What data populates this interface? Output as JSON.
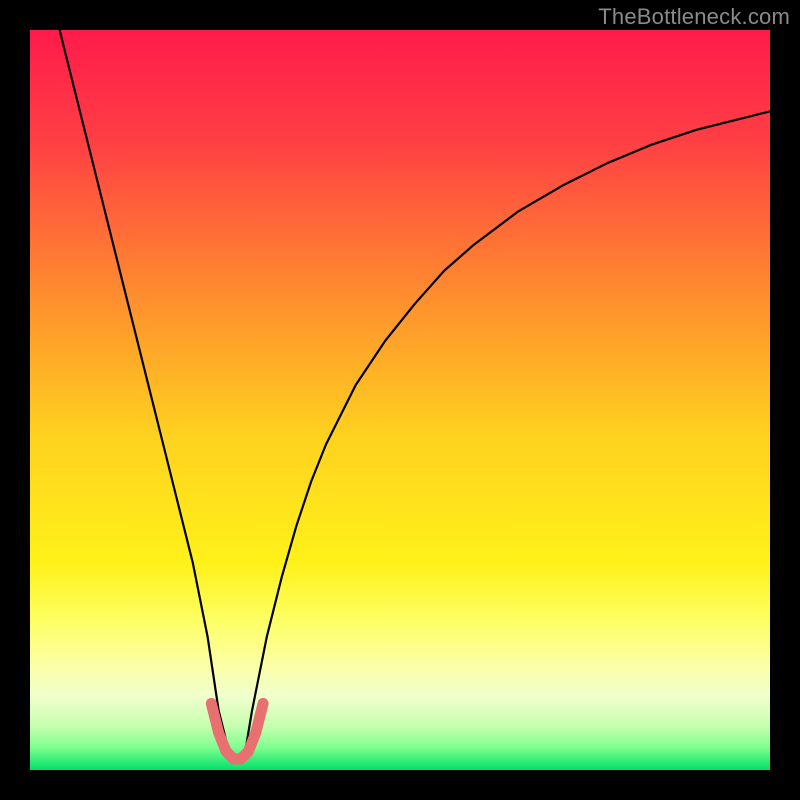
{
  "watermark": "TheBottleneck.com",
  "chart_data": {
    "type": "line",
    "title": "",
    "xlabel": "",
    "ylabel": "",
    "xlim": [
      0,
      100
    ],
    "ylim": [
      0,
      100
    ],
    "legend": false,
    "grid": false,
    "background_gradient": {
      "stops": [
        {
          "offset": 0.0,
          "color": "#ff1b4b"
        },
        {
          "offset": 0.15,
          "color": "#ff3f44"
        },
        {
          "offset": 0.35,
          "color": "#ff8a2f"
        },
        {
          "offset": 0.55,
          "color": "#ffd21f"
        },
        {
          "offset": 0.72,
          "color": "#fff11a"
        },
        {
          "offset": 0.8,
          "color": "#fdff66"
        },
        {
          "offset": 0.86,
          "color": "#fbffa8"
        },
        {
          "offset": 0.9,
          "color": "#f0ffcc"
        },
        {
          "offset": 0.94,
          "color": "#c7ffb0"
        },
        {
          "offset": 0.97,
          "color": "#7dff8e"
        },
        {
          "offset": 1.0,
          "color": "#00e06a"
        }
      ]
    },
    "series": [
      {
        "name": "bottleneck-curve",
        "color": "#000000",
        "width": 2.2,
        "x": [
          4,
          6,
          8,
          10,
          12,
          14,
          16,
          18,
          20,
          22,
          24,
          25.5,
          27,
          28,
          29,
          30,
          32,
          34,
          36,
          38,
          40,
          44,
          48,
          52,
          56,
          60,
          66,
          72,
          78,
          84,
          90,
          96,
          100
        ],
        "y": [
          100,
          92,
          84,
          76,
          68,
          60,
          52,
          44,
          36,
          28,
          18,
          8,
          2,
          1,
          2,
          8,
          18,
          26,
          33,
          39,
          44,
          52,
          58,
          63,
          67.5,
          71,
          75.5,
          79,
          82,
          84.5,
          86.5,
          88,
          89
        ]
      },
      {
        "name": "optimal-marker",
        "color": "#e97070",
        "width": 11,
        "linecap": "round",
        "x": [
          24.5,
          25.5,
          26.5,
          27.5,
          28.5,
          29.5,
          30.5,
          31.5
        ],
        "y": [
          9,
          5,
          2.5,
          1.5,
          1.5,
          2.5,
          5,
          9
        ]
      }
    ],
    "annotations": []
  }
}
